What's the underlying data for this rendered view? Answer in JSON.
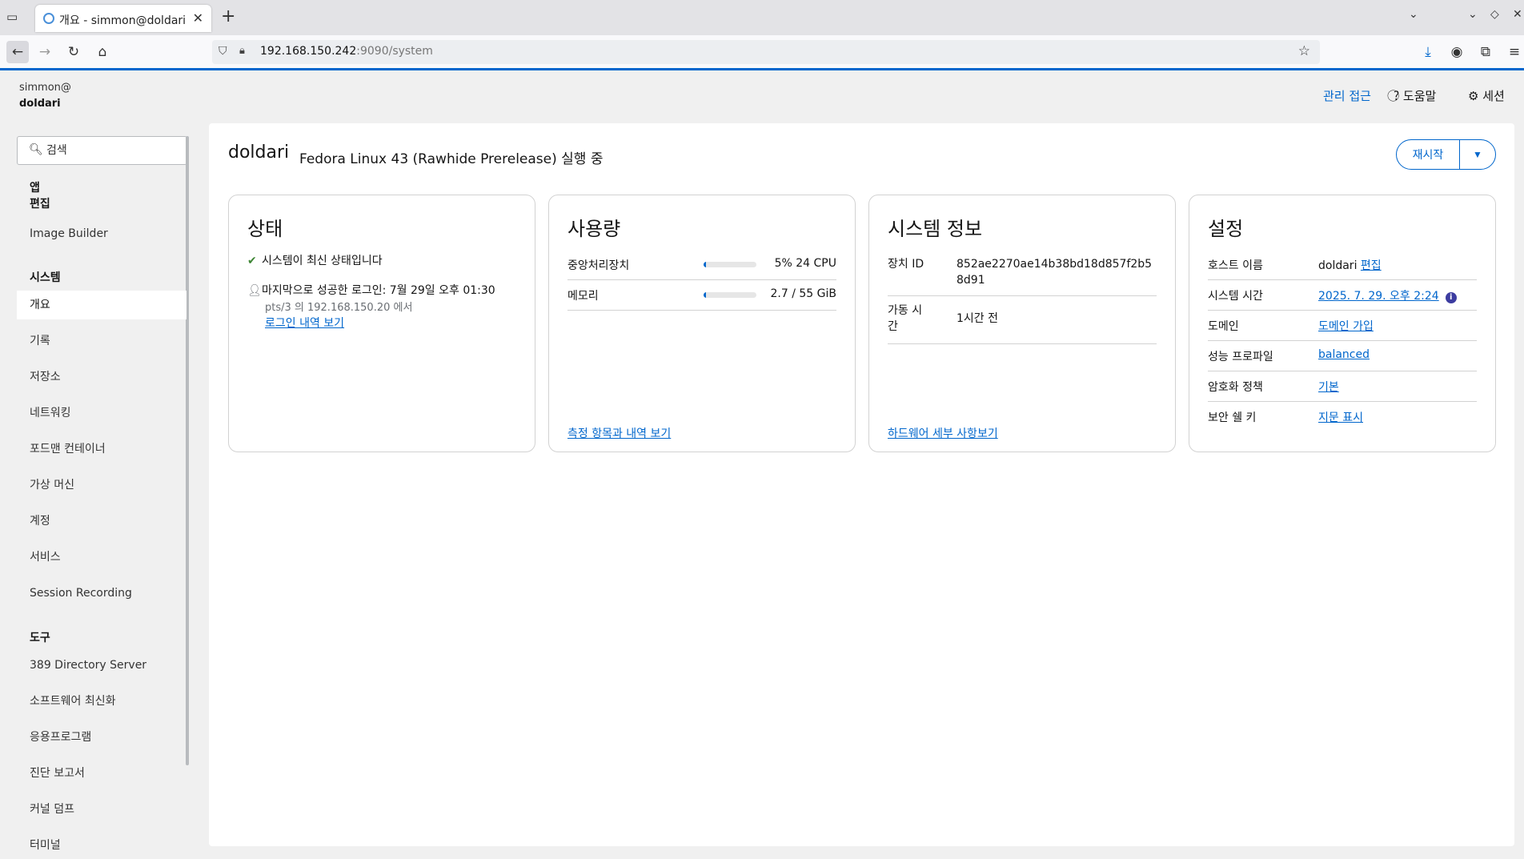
{
  "browser": {
    "tab_title": "개요 - simmon@doldari",
    "url_host": "192.168.150.242",
    "url_rest": ":9090/system"
  },
  "topbar": {
    "user": "simmon@",
    "host": "doldari",
    "admin_access": "관리 접근",
    "help": "도움말",
    "session": "세션"
  },
  "sidebar": {
    "search_placeholder": "검색",
    "apps_heading": "앱",
    "edit_heading": "편집",
    "apps": [
      "Image Builder"
    ],
    "system_heading": "시스템",
    "system_items": [
      "개요",
      "기록",
      "저장소",
      "네트워킹",
      "포드맨 컨테이너",
      "가상 머신",
      "계정",
      "서비스",
      "Session Recording"
    ],
    "tools_heading": "도구",
    "tool_items": [
      "389 Directory Server",
      "소프트웨어 최신화",
      "응용프로그램",
      "진단 보고서",
      "커널 덤프",
      "터미널"
    ]
  },
  "page": {
    "hostname": "doldari",
    "os": "Fedora Linux 43 (Rawhide Prerelease) 실행 중",
    "restart_label": "재시작"
  },
  "status_card": {
    "title": "상태",
    "uptodate": "시스템이 최신 상태입니다",
    "last_login": "마지막으로 성공한 로그인: 7월 29일 오후 01:30",
    "last_login_from": "pts/3 의 192.168.150.20 에서",
    "history_link": "로그인 내역 보기"
  },
  "usage_card": {
    "title": "사용량",
    "cpu_label": "중앙처리장치",
    "cpu_value": "5% 24 CPU",
    "cpu_percent": 5,
    "mem_label": "메모리",
    "mem_value": "2.7 / 55 GiB",
    "mem_percent": 5,
    "link": "측정 항목과 내역 보기"
  },
  "sysinfo_card": {
    "title": "시스템 정보",
    "machine_id_label": "장치 ID",
    "machine_id": "852ae2270ae14b38bd18d857f2b58d91",
    "uptime_label": "가동 시간",
    "uptime": "1시간 전",
    "link": "하드웨어 세부 사항보기"
  },
  "config_card": {
    "title": "설정",
    "hostname_label": "호스트 이름",
    "hostname_value": "doldari",
    "hostname_edit": "편집",
    "time_label": "시스템 시간",
    "time_value": "2025. 7. 29. 오후 2:24",
    "domain_label": "도메인",
    "domain_value": "도메인 가입",
    "profile_label": "성능 프로파일",
    "profile_value": "balanced",
    "crypto_label": "암호화 정책",
    "crypto_value": "기본",
    "ssh_label": "보안 쉘 키",
    "ssh_value": "지문 표시"
  },
  "colors": {
    "accent": "#0066cc",
    "success": "#3e8635",
    "info": "#3c3ca0"
  }
}
